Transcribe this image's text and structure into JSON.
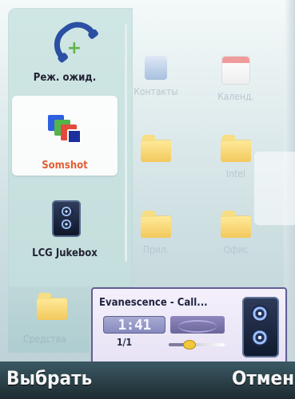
{
  "background_grid": {
    "items": [
      {
        "label": "Контакты",
        "icon": "contacts-icon"
      },
      {
        "label": "Календ.",
        "icon": "calendar-icon"
      },
      {
        "label": "",
        "icon": "folder-icon"
      },
      {
        "label": "Intel",
        "icon": "folder-icon"
      },
      {
        "label": "Прил.",
        "icon": "folder-icon"
      },
      {
        "label": "Офис",
        "icon": "folder-icon"
      }
    ],
    "bottom_item": {
      "label": "Средства",
      "icon": "folder-icon"
    }
  },
  "app_switcher": {
    "items": [
      {
        "label": "Реж. ожид.",
        "icon": "phone-icon",
        "selected": false
      },
      {
        "label": "Somshot",
        "icon": "screenshot-icon",
        "selected": true
      },
      {
        "label": "LCG Jukebox",
        "icon": "jukebox-icon",
        "selected": false
      }
    ]
  },
  "player": {
    "title": "Evanescence - Call...",
    "time": "1:41",
    "counter": "1/1",
    "progress": 0.35
  },
  "softkeys": {
    "left": "Выбрать",
    "right": "Отмена"
  },
  "colors": {
    "accent": "#e25f35",
    "player_border": "#615f96",
    "softkey_bar": "#2b3d44"
  }
}
